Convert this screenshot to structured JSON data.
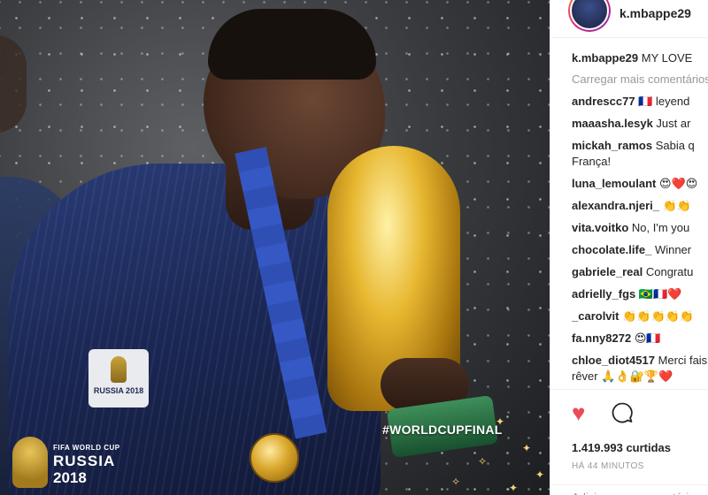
{
  "photo": {
    "hashtag": "#WORLDCUPFINAL",
    "sponsor_text": "RUSSIA 2018",
    "logo": {
      "line1": "FIFA WORLD CUP",
      "line2": "RUSSIA",
      "line3": "2018"
    }
  },
  "post": {
    "username": "k.mbappe29",
    "caption_user": "k.mbappe29",
    "caption_text": "MY LOVE",
    "load_more": "Carregar mais comentários",
    "comments": [
      {
        "user": "andrescc77",
        "text": "🇫🇷 leyend"
      },
      {
        "user": "maaasha.lesyk",
        "text": "Just ar"
      },
      {
        "user": "mickah_ramos",
        "text": "Sabia q França!"
      },
      {
        "user": "luna_lemoulant",
        "text": "😍❤️😍"
      },
      {
        "user": "alexandra.njeri_",
        "text": "👏👏"
      },
      {
        "user": "vita.voitko",
        "text": "No, I'm you"
      },
      {
        "user": "chocolate.life_",
        "text": "Winner"
      },
      {
        "user": "gabriele_real",
        "text": "Congratu"
      },
      {
        "user": "adrielly_fgs",
        "text": "🇧🇷🇫🇷❤️"
      },
      {
        "user": "_carolvit",
        "text": "👏👏👏👏👏"
      },
      {
        "user": "fa.nny8272",
        "text": "😍🇫🇷"
      },
      {
        "user": "chloe_diot4517",
        "text": "Merci fais rêver 🙏👌🔐🏆❤️"
      }
    ],
    "likes": "1.419.993 curtidas",
    "time": "HÁ 44 MINUTOS",
    "add_comment_placeholder": "Adicione um comentário..."
  },
  "colors": {
    "heart": "#ed4956",
    "text": "#262626",
    "muted": "#999999"
  },
  "icons": {
    "like": "heart-icon",
    "comment": "comment-bubble-icon"
  }
}
